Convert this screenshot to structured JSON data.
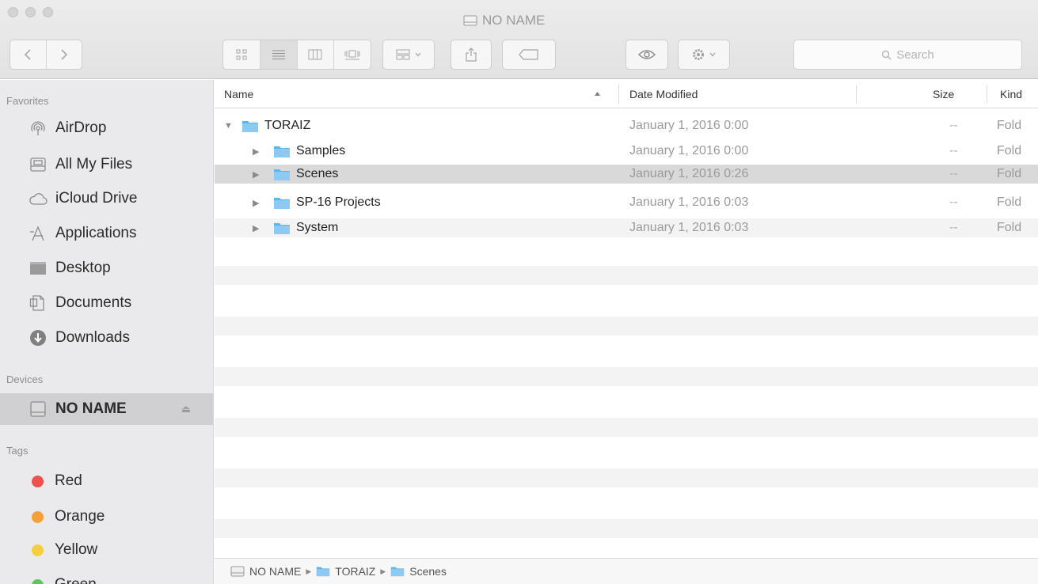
{
  "window": {
    "title": "NO NAME"
  },
  "toolbar": {
    "icons": [
      "back-icon",
      "forward-icon",
      "icon-view-icon",
      "list-view-icon",
      "column-view-icon",
      "cover-flow-icon",
      "arrange-icon",
      "share-icon",
      "tag-icon",
      "quick-look-icon",
      "action-gear-icon"
    ],
    "search_placeholder": "Search"
  },
  "sidebar": {
    "favorites_label": "Favorites",
    "favorites": [
      {
        "label": "AirDrop",
        "icon": "airdrop-icon"
      },
      {
        "label": "All My Files",
        "icon": "all-files-icon"
      },
      {
        "label": "iCloud Drive",
        "icon": "cloud-icon"
      },
      {
        "label": "Applications",
        "icon": "applications-icon"
      },
      {
        "label": "Desktop",
        "icon": "desktop-icon"
      },
      {
        "label": "Documents",
        "icon": "documents-icon"
      },
      {
        "label": "Downloads",
        "icon": "downloads-icon"
      }
    ],
    "devices_label": "Devices",
    "devices": [
      {
        "label": "NO NAME",
        "icon": "drive-icon",
        "eject": "⏏"
      }
    ],
    "tags_label": "Tags",
    "tags": [
      {
        "label": "Red",
        "color": "#f14e4e"
      },
      {
        "label": "Orange",
        "color": "#f5a03a"
      },
      {
        "label": "Yellow",
        "color": "#f6cf3f"
      },
      {
        "label": "Green",
        "color": "#5ac85a"
      }
    ]
  },
  "columns": {
    "name": "Name",
    "date": "Date Modified",
    "size": "Size",
    "kind": "Kind"
  },
  "files": [
    {
      "name": "TORAIZ",
      "date": "January 1, 2016 0:00",
      "size": "--",
      "kind": "Fold",
      "expanded": true,
      "level": 0
    },
    {
      "name": "Samples",
      "date": "January 1, 2016 0:00",
      "size": "--",
      "kind": "Fold",
      "expanded": false,
      "level": 1
    },
    {
      "name": "Scenes",
      "date": "January 1, 2016 0:26",
      "size": "--",
      "kind": "Fold",
      "expanded": false,
      "level": 1,
      "selected": true
    },
    {
      "name": "SP-16 Projects",
      "date": "January 1, 2016 0:03",
      "size": "--",
      "kind": "Fold",
      "expanded": false,
      "level": 1
    },
    {
      "name": "System",
      "date": "January 1, 2016 0:03",
      "size": "--",
      "kind": "Fold",
      "expanded": false,
      "level": 1
    }
  ],
  "pathbar": [
    "NO NAME",
    "TORAIZ",
    "Scenes"
  ],
  "colors": {
    "folder": "#58b4ee",
    "selection": "#d9d9d9"
  }
}
